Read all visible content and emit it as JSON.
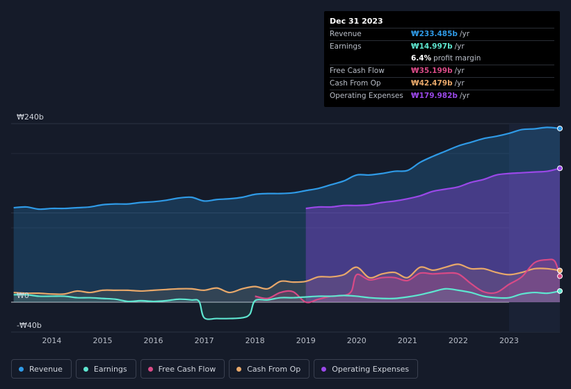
{
  "colors": {
    "revenue": "#2f9ae6",
    "earnings": "#5ee6d0",
    "free_cash_flow": "#d84a86",
    "cash_from_op": "#e8a86a",
    "operating_expenses": "#9a48e8"
  },
  "tooltip": {
    "date": "Dec 31 2023",
    "rows": [
      {
        "label": "Revenue",
        "value": "₩233.485b",
        "unit": "/yr",
        "color": "#2f9ae6"
      },
      {
        "label": "Earnings",
        "value": "₩14.997b",
        "unit": "/yr",
        "color": "#5ee6d0"
      },
      {
        "label": "",
        "value": "6.4%",
        "unit": "profit margin",
        "color": "#ffffff"
      },
      {
        "label": "Free Cash Flow",
        "value": "₩35.199b",
        "unit": "/yr",
        "color": "#d84a86"
      },
      {
        "label": "Cash From Op",
        "value": "₩42.479b",
        "unit": "/yr",
        "color": "#e8a86a"
      },
      {
        "label": "Operating Expenses",
        "value": "₩179.982b",
        "unit": "/yr",
        "color": "#9a48e8"
      }
    ]
  },
  "legend": [
    {
      "label": "Revenue",
      "color": "#2f9ae6"
    },
    {
      "label": "Earnings",
      "color": "#5ee6d0"
    },
    {
      "label": "Free Cash Flow",
      "color": "#d84a86"
    },
    {
      "label": "Cash From Op",
      "color": "#e8a86a"
    },
    {
      "label": "Operating Expenses",
      "color": "#9a48e8"
    }
  ],
  "chart_data": {
    "type": "area",
    "title": "",
    "xlabel": "",
    "ylabel": "",
    "ylim": [
      -40,
      240
    ],
    "xlim": [
      2013.2,
      2024.0
    ],
    "y_tick_labels": [
      {
        "value": 240,
        "label": "₩240b"
      },
      {
        "value": 0,
        "label": "₩0"
      },
      {
        "value": -40,
        "label": "-₩40b"
      }
    ],
    "x_ticks": [
      2014,
      2015,
      2016,
      2017,
      2018,
      2019,
      2020,
      2021,
      2022,
      2023
    ],
    "x_tick_labels": [
      "2014",
      "2015",
      "2016",
      "2017",
      "2018",
      "2019",
      "2020",
      "2021",
      "2022",
      "2023"
    ],
    "grid": true,
    "highlight_start": 2023.0,
    "series": [
      {
        "name": "Revenue",
        "key": "revenue",
        "x": [
          2013.25,
          2013.5,
          2013.75,
          2014.0,
          2014.25,
          2014.5,
          2014.75,
          2015.0,
          2015.25,
          2015.5,
          2015.75,
          2016.0,
          2016.25,
          2016.5,
          2016.75,
          2017.0,
          2017.25,
          2017.5,
          2017.75,
          2018.0,
          2018.25,
          2018.5,
          2018.75,
          2019.0,
          2019.25,
          2019.5,
          2019.75,
          2020.0,
          2020.25,
          2020.5,
          2020.75,
          2021.0,
          2021.25,
          2021.5,
          2021.75,
          2022.0,
          2022.25,
          2022.5,
          2022.75,
          2023.0,
          2023.25,
          2023.5,
          2023.75,
          2024.0
        ],
        "y": [
          127,
          128,
          125,
          126,
          126,
          127,
          128,
          131,
          132,
          132,
          134,
          135,
          137,
          140,
          141,
          136,
          138,
          139,
          141,
          145,
          146,
          146,
          147,
          150,
          153,
          158,
          163,
          171,
          171,
          173,
          176,
          177,
          188,
          196,
          203,
          210,
          215,
          220,
          223,
          227,
          232,
          233,
          235,
          233.5
        ]
      },
      {
        "name": "Earnings",
        "key": "earnings",
        "x": [
          2013.25,
          2013.5,
          2013.75,
          2014.0,
          2014.25,
          2014.5,
          2014.75,
          2015.0,
          2015.25,
          2015.5,
          2015.75,
          2016.0,
          2016.25,
          2016.5,
          2016.75,
          2016.9,
          2017.0,
          2017.25,
          2017.5,
          2017.75,
          2017.9,
          2018.0,
          2018.25,
          2018.5,
          2018.75,
          2019.0,
          2019.25,
          2019.5,
          2019.75,
          2020.0,
          2020.25,
          2020.5,
          2020.75,
          2021.0,
          2021.25,
          2021.5,
          2021.75,
          2022.0,
          2022.25,
          2022.5,
          2022.75,
          2023.0,
          2023.25,
          2023.5,
          2023.75,
          2024.0
        ],
        "y": [
          10,
          10,
          8,
          8,
          8,
          6,
          6,
          5,
          4,
          1,
          2,
          1,
          2,
          4,
          3,
          1,
          -21,
          -22,
          -22,
          -21,
          -16,
          2,
          3,
          6,
          6,
          7,
          8,
          8,
          9,
          8,
          6,
          5,
          5,
          7,
          10,
          14,
          18,
          16,
          13,
          8,
          6,
          6,
          11,
          13,
          12,
          15
        ]
      },
      {
        "name": "Free Cash Flow",
        "key": "free_cash_flow",
        "x": [
          2018.0,
          2018.25,
          2018.5,
          2018.75,
          2019.0,
          2019.25,
          2019.5,
          2019.75,
          2019.9,
          2020.0,
          2020.25,
          2020.5,
          2020.75,
          2021.0,
          2021.25,
          2021.5,
          2021.75,
          2022.0,
          2022.25,
          2022.5,
          2022.75,
          2023.0,
          2023.25,
          2023.5,
          2023.75,
          2023.9,
          2024.0
        ],
        "y": [
          8,
          5,
          13,
          14,
          0,
          4,
          8,
          9,
          15,
          37,
          30,
          33,
          33,
          29,
          39,
          38,
          39,
          38,
          25,
          14,
          13,
          24,
          34,
          53,
          57,
          55,
          35
        ]
      },
      {
        "name": "Cash From Op",
        "key": "cash_from_op",
        "x": [
          2013.25,
          2013.5,
          2013.75,
          2014.0,
          2014.25,
          2014.5,
          2014.75,
          2015.0,
          2015.25,
          2015.5,
          2015.75,
          2016.0,
          2016.25,
          2016.5,
          2016.75,
          2017.0,
          2017.25,
          2017.5,
          2017.75,
          2018.0,
          2018.25,
          2018.5,
          2018.75,
          2019.0,
          2019.25,
          2019.5,
          2019.75,
          2020.0,
          2020.25,
          2020.5,
          2020.75,
          2021.0,
          2021.25,
          2021.5,
          2021.75,
          2022.0,
          2022.25,
          2022.5,
          2022.75,
          2023.0,
          2023.25,
          2023.5,
          2023.75,
          2024.0
        ],
        "y": [
          13,
          12,
          12,
          11,
          11,
          15,
          13,
          16,
          16,
          16,
          15,
          16,
          17,
          18,
          18,
          16,
          19,
          13,
          18,
          21,
          18,
          28,
          27,
          28,
          34,
          34,
          37,
          47,
          33,
          38,
          40,
          33,
          47,
          43,
          47,
          51,
          45,
          45,
          40,
          37,
          40,
          45,
          45,
          42.5
        ]
      },
      {
        "name": "Operating Expenses",
        "key": "operating_expenses",
        "x": [
          2019.0,
          2019.25,
          2019.5,
          2019.75,
          2020.0,
          2020.25,
          2020.5,
          2020.75,
          2021.0,
          2021.25,
          2021.5,
          2021.75,
          2022.0,
          2022.25,
          2022.5,
          2022.75,
          2023.0,
          2023.25,
          2023.5,
          2023.75,
          2024.0
        ],
        "y": [
          126,
          128,
          128,
          130,
          130,
          131,
          134,
          136,
          139,
          143,
          149,
          152,
          155,
          161,
          165,
          171,
          173,
          174,
          175,
          176,
          180
        ]
      }
    ]
  }
}
